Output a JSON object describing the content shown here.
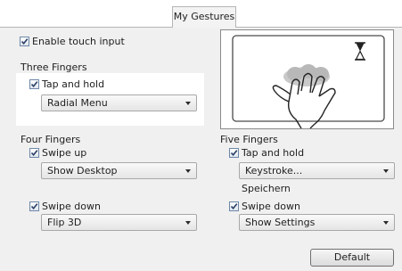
{
  "tabs": {
    "active_label": "My Gestures"
  },
  "touch": {
    "enable_label": "Enable touch input",
    "enabled": true
  },
  "three_fingers": {
    "title": "Three Fingers",
    "tap_hold_label": "Tap and hold",
    "tap_hold_action": "Radial Menu"
  },
  "four_fingers": {
    "title": "Four Fingers",
    "swipe_up_label": "Swipe up",
    "swipe_up_action": "Show Desktop",
    "swipe_down_label": "Swipe down",
    "swipe_down_action": "Flip 3D"
  },
  "five_fingers": {
    "title": "Five Fingers",
    "tap_hold_label": "Tap and hold",
    "tap_hold_action": "Keystroke...",
    "tap_hold_note": "Speichern",
    "swipe_down_label": "Swipe down",
    "swipe_down_action": "Show Settings"
  },
  "preview": {
    "icons": [
      "hourglass-icon",
      "hand-gesture-icon"
    ]
  },
  "buttons": {
    "default_label": "Default"
  },
  "colors": {
    "checkbox_border": "#6d87a7",
    "panel_bg": "#f0f0f0"
  }
}
